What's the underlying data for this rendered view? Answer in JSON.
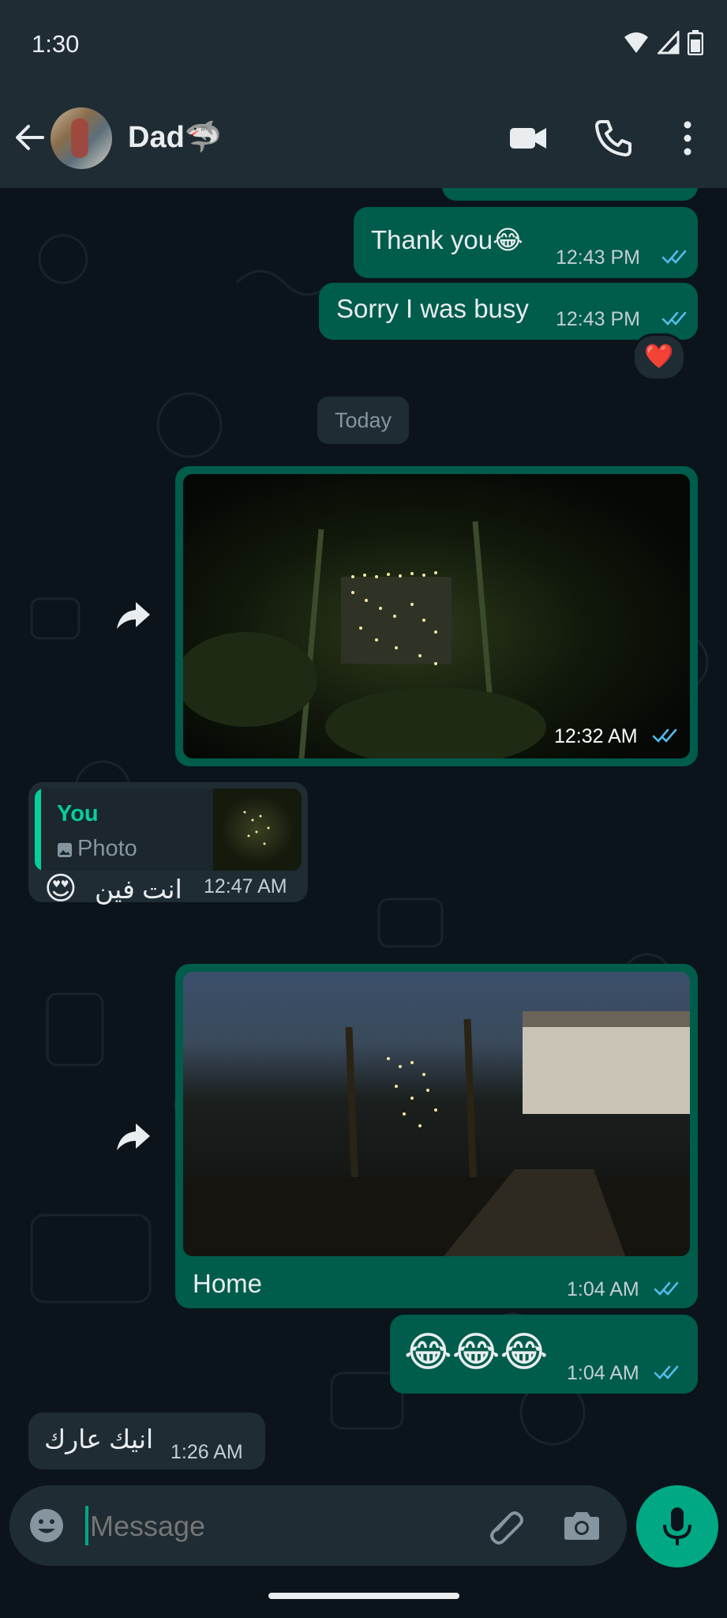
{
  "status_bar": {
    "time": "1:30"
  },
  "header": {
    "contact_name": "Dad🦈"
  },
  "date_chip": "Today",
  "messages": [
    {
      "direction": "out",
      "text": "Thank you😂",
      "time": "12:43 PM"
    },
    {
      "direction": "out",
      "text": "Sorry I was busy",
      "time": "12:43 PM",
      "reaction": "❤️"
    },
    {
      "direction": "out",
      "type": "photo",
      "time": "12:32 AM"
    },
    {
      "direction": "in",
      "reply_to": {
        "author": "You",
        "label": "Photo"
      },
      "text": "انت فين",
      "emoji": "😍",
      "time": "12:47 AM"
    },
    {
      "direction": "out",
      "type": "photo",
      "caption": "Home",
      "time": "1:04 AM"
    },
    {
      "direction": "out",
      "text": "😂😂😂",
      "time": "1:04 AM"
    },
    {
      "direction": "in",
      "text": "انيك عارك",
      "time": "1:26 AM"
    }
  ],
  "composer": {
    "placeholder": "Message"
  },
  "colors": {
    "outgoing": "#005c4b",
    "incoming": "#1f2c34",
    "accent": "#00a884",
    "read_ticks": "#53bdeb"
  }
}
